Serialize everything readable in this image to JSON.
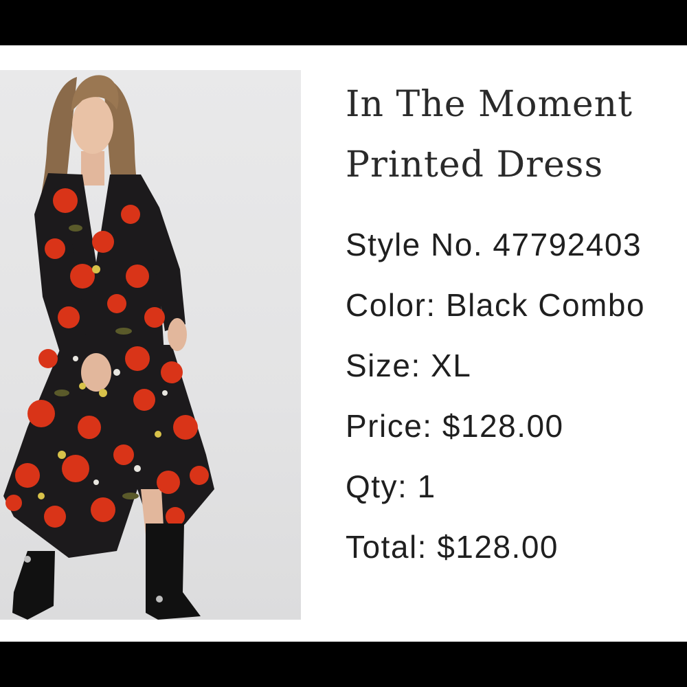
{
  "product": {
    "title_line1": "In The Moment",
    "title_line2": "Printed Dress",
    "image_alt": "Model wearing black floral printed maxi dress with red poppies and black boots"
  },
  "details": {
    "style": "Style No. 47792403",
    "color": "Color: Black Combo",
    "size": "Size: XL",
    "price": "Price: $128.00",
    "qty": "Qty: 1",
    "total": "Total: $128.00"
  },
  "colors": {
    "frame": "#000000",
    "background": "#ffffff",
    "text": "#1f1f1f",
    "dress_base": "#1c1a1c",
    "flower_red": "#d93418"
  }
}
